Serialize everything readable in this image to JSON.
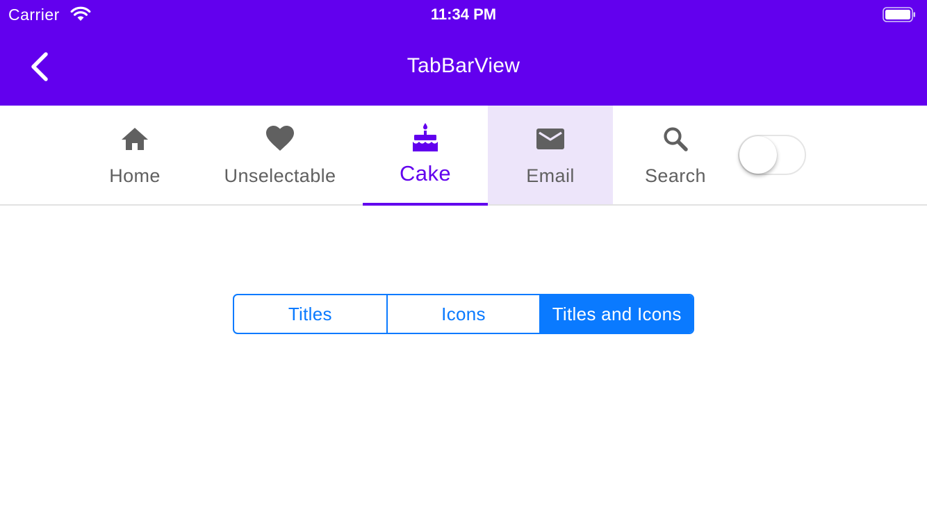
{
  "status_bar": {
    "carrier": "Carrier",
    "time": "11:34 PM"
  },
  "nav": {
    "title": "TabBarView",
    "back_icon": "chevron-left-icon"
  },
  "colors": {
    "primary": "#6200EE",
    "tab_text": "#606060",
    "highlight": "#EDE5FA",
    "segment_accent": "#0A7AFF"
  },
  "tabs": [
    {
      "label": "Home",
      "icon": "home-icon",
      "selected": false
    },
    {
      "label": "Unselectable",
      "icon": "heart-icon",
      "selected": false
    },
    {
      "label": "Cake",
      "icon": "cake-icon",
      "selected": true
    },
    {
      "label": "Email",
      "icon": "email-icon",
      "selected": false,
      "highlighted": true
    },
    {
      "label": "Search",
      "icon": "search-icon",
      "selected": false
    }
  ],
  "toggle": {
    "on": false
  },
  "segmented": {
    "options": [
      "Titles",
      "Icons",
      "Titles and Icons"
    ],
    "selected": "Titles and Icons"
  }
}
